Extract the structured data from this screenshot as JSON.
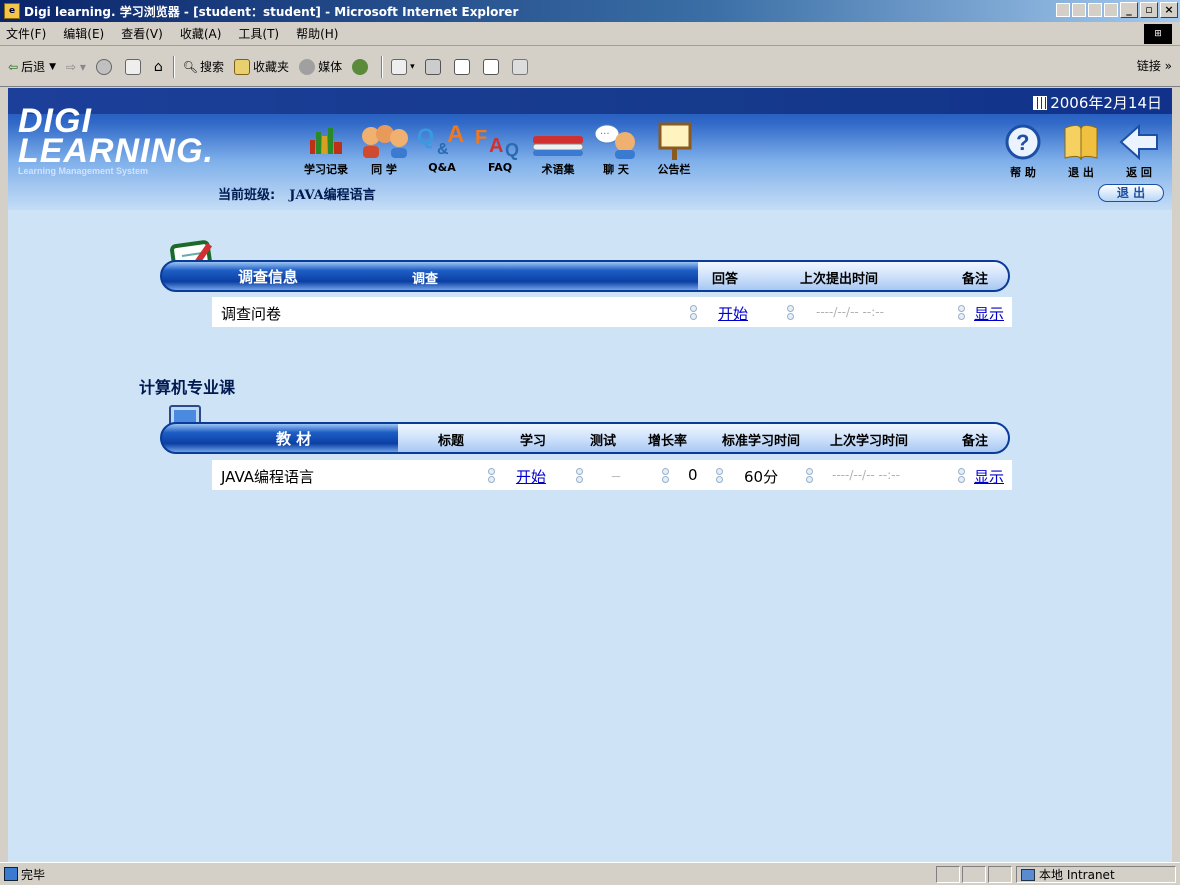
{
  "window": {
    "title": "Digi learning. 学习浏览器 - [student：student] - Microsoft Internet Explorer",
    "buttons": [
      "_",
      "▫",
      "×"
    ]
  },
  "menu": [
    "文件(F)",
    "编辑(E)",
    "查看(V)",
    "收藏(A)",
    "工具(T)",
    "帮助(H)"
  ],
  "toolbar": {
    "back": "后退",
    "search": "搜索",
    "favorites": "收藏夹",
    "media": "媒体",
    "links": "链接 »"
  },
  "header": {
    "logo_line1": "DIGI",
    "logo_line2": "LEARNING.",
    "logo_sub": "Learning Management System",
    "date": "2006年2月14日",
    "class_label": "当前班级:",
    "class_name": "JAVA编程语言",
    "logout_button": "退 出",
    "nav": [
      {
        "label": "学习记录",
        "icon": "chart-icon"
      },
      {
        "label": "同 学",
        "icon": "classmates-icon"
      },
      {
        "label": "Q&A",
        "icon": "qa-icon"
      },
      {
        "label": "FAQ",
        "icon": "faq-icon"
      },
      {
        "label": "术语集",
        "icon": "glossary-icon"
      },
      {
        "label": "聊 天",
        "icon": "chat-icon"
      },
      {
        "label": "公告栏",
        "icon": "bulletin-icon"
      }
    ],
    "right_nav": [
      {
        "label": "帮 助",
        "icon": "help-icon"
      },
      {
        "label": "退 出",
        "icon": "exit-icon"
      },
      {
        "label": "返 回",
        "icon": "back-icon"
      }
    ]
  },
  "survey": {
    "headers": {
      "section": "调查信息",
      "survey": "调查",
      "answer": "回答",
      "last_submit": "上次提出时间",
      "note": "备注"
    },
    "rows": [
      {
        "name": "调查问卷",
        "answer": "开始",
        "last_submit": "----/--/-- --:--",
        "note": "显示"
      }
    ]
  },
  "course_section_title": "计算机专业课",
  "courses": {
    "headers": {
      "section": "教 材",
      "title": "标题",
      "study": "学习",
      "test": "测试",
      "growth": "增长率",
      "std_time": "标准学习时间",
      "last_study": "上次学习时间",
      "note": "备注"
    },
    "rows": [
      {
        "title": "JAVA编程语言",
        "study": "开始",
        "test": "－",
        "growth": "0",
        "std_time": "60分",
        "last_study": "----/--/-- --:--",
        "note": "显示"
      }
    ]
  },
  "status": {
    "text": "完毕",
    "zone": "本地 Intranet"
  }
}
